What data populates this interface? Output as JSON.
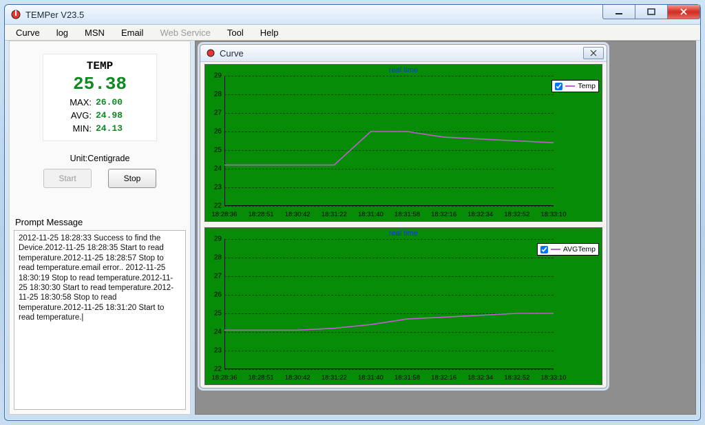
{
  "window": {
    "title": "TEMPer V23.5",
    "min": "─",
    "max": "☐",
    "close": "✕"
  },
  "menu": {
    "items": [
      "Curve",
      "log",
      "MSN",
      "Email",
      "Web Service",
      "Tool",
      "Help"
    ],
    "disabled_idx": 4
  },
  "temp": {
    "heading": "TEMP",
    "current": "25.38",
    "max_label": "MAX:",
    "max": "26.00",
    "avg_label": "AVG:",
    "avg": "24.98",
    "min_label": "MIN:",
    "min": "24.13",
    "unit": "Unit:Centigrade",
    "start": "Start",
    "stop": "Stop"
  },
  "prompt": {
    "label": "Prompt Message",
    "text": "2012-11-25 18:28:33 Success to find the Device.2012-11-25 18:28:35 Start to read temperature.2012-11-25 18:28:57 Stop to read temperature.email error.. 2012-11-25 18:30:19 Stop to read temperature.2012-11-25 18:30:30 Start to read temperature.2012-11-25 18:30:58 Stop to read temperature.2012-11-25 18:31:20 Start to read temperature.|"
  },
  "inner": {
    "title": "Curve",
    "close": "✕"
  },
  "chart_data": [
    {
      "type": "line",
      "title": "real time",
      "legend": "Temp",
      "yticks": [
        22,
        23,
        24,
        25,
        26,
        27,
        28,
        29
      ],
      "ylim": [
        22,
        29
      ],
      "xticks": [
        "18:28:36",
        "18:28:51",
        "18:30:42",
        "18:31:22",
        "18:31:40",
        "18:31:58",
        "18:32:16",
        "18:32:34",
        "18:32:52",
        "18:33:10"
      ],
      "x": [
        0,
        1,
        2,
        3,
        4,
        5,
        6,
        7,
        8,
        9
      ],
      "values": [
        24.2,
        24.2,
        24.2,
        24.2,
        26.0,
        26.0,
        25.7,
        25.6,
        25.5,
        25.4
      ]
    },
    {
      "type": "line",
      "title": "real time",
      "legend": "AVGTemp",
      "yticks": [
        22,
        23,
        24,
        25,
        26,
        27,
        28,
        29
      ],
      "ylim": [
        22,
        29
      ],
      "xticks": [
        "18:28:36",
        "18:28:51",
        "18:30:42",
        "18:31:22",
        "18:31:40",
        "18:31:58",
        "18:32:16",
        "18:32:34",
        "18:32:52",
        "18:33:10"
      ],
      "x": [
        0,
        1,
        2,
        3,
        4,
        5,
        6,
        7,
        8,
        9
      ],
      "values": [
        24.1,
        24.1,
        24.1,
        24.2,
        24.4,
        24.7,
        24.8,
        24.9,
        25.0,
        25.0
      ]
    }
  ]
}
